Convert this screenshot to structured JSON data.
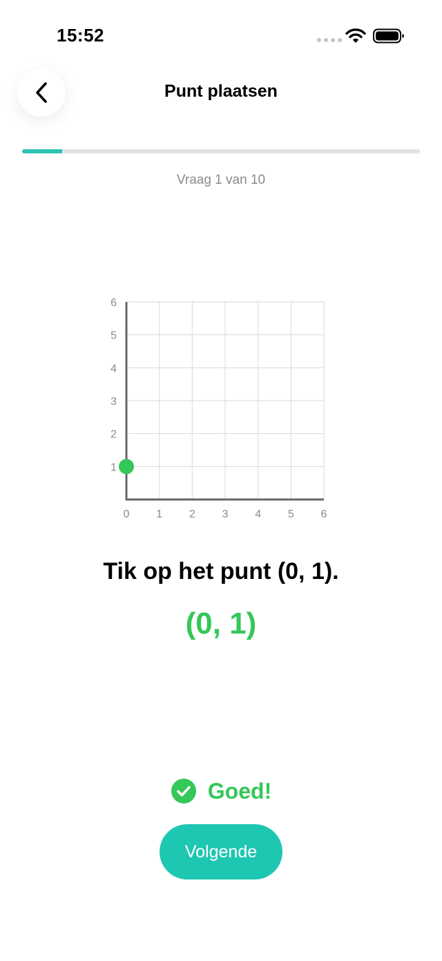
{
  "status_bar": {
    "time": "15:52"
  },
  "header": {
    "title": "Punt plaatsen",
    "back_icon": "chevron-left-icon"
  },
  "progress": {
    "label": "Vraag 1 van 10",
    "current": 1,
    "total": 10,
    "fraction": 0.1
  },
  "question": {
    "instruction": "Tik op het punt (0, 1).",
    "answer_text": "(0, 1)"
  },
  "feedback": {
    "text": "Goed!",
    "icon": "check-circle-icon"
  },
  "actions": {
    "next_label": "Volgende"
  },
  "colors": {
    "accent": "#1ec7b1",
    "success": "#34c759",
    "axis": "#666666",
    "grid": "#d9d9d9",
    "tick_text": "#8a8a8a"
  },
  "chart_data": {
    "type": "scatter",
    "xlim": [
      0,
      6
    ],
    "ylim": [
      0,
      6
    ],
    "x_ticks": [
      "0",
      "1",
      "2",
      "3",
      "4",
      "5",
      "6"
    ],
    "y_ticks": [
      "1",
      "2",
      "3",
      "4",
      "5",
      "6"
    ],
    "grid": true,
    "points": [
      {
        "x": 0,
        "y": 1
      }
    ]
  }
}
